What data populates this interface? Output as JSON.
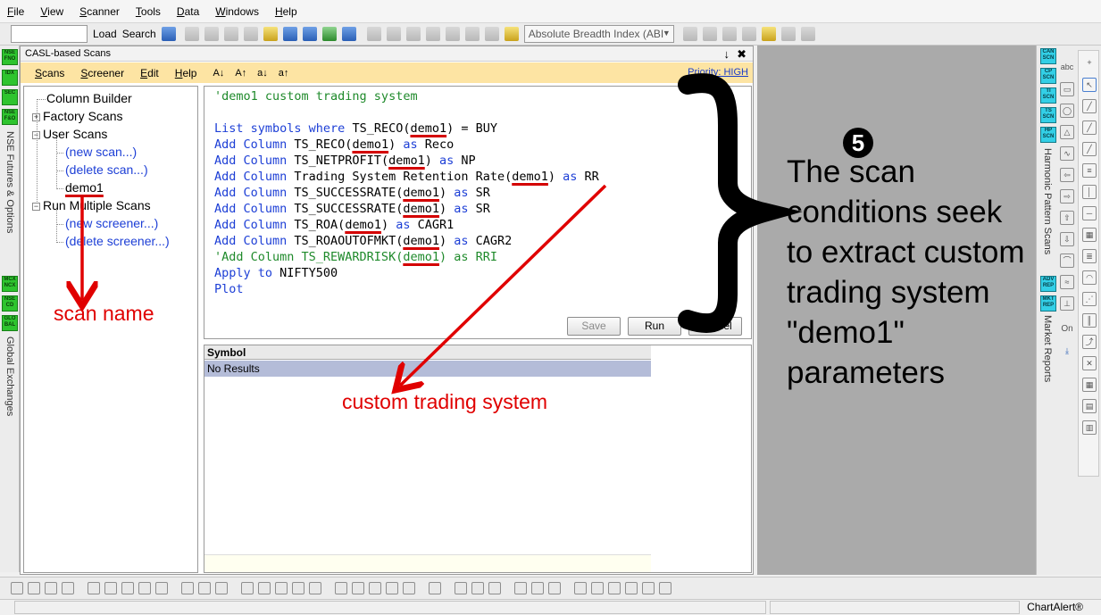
{
  "menu": [
    "File",
    "View",
    "Scanner",
    "Tools",
    "Data",
    "Windows",
    "Help"
  ],
  "toolbar": {
    "load": "Load",
    "search": "Search",
    "breadth_select": "Absolute Breadth Index (ABI"
  },
  "left_sidebar": {
    "buttons_top": [
      "NSE FNO",
      "IDX",
      "SEC",
      "NSE F&O"
    ],
    "label_top": "NSE Futures & Options",
    "buttons_bottom": [
      "MCX NCX",
      "NSE CD",
      "GLO BAL"
    ],
    "label_bottom": "Global Exchanges"
  },
  "window": {
    "title": "CASL-based Scans",
    "pin": "↓",
    "close": "✖",
    "menu": [
      "Scans",
      "Screener",
      "Edit",
      "Help"
    ],
    "font_sizes": [
      "A↓",
      "A↑",
      "a↓",
      "a↑"
    ],
    "priority": "Priority: HIGH"
  },
  "tree": {
    "column_builder": "Column Builder",
    "factory_scans": "Factory Scans",
    "user_scans": "User Scans",
    "new_scan": "(new scan...)",
    "delete_scan": "(delete scan...)",
    "demo1": "demo1",
    "run_multiple": "Run Multiple Scans",
    "new_screener": "(new screener...)",
    "delete_screener": "(delete screener...)"
  },
  "editor": {
    "comment": "'demo1 custom trading system",
    "lines": [
      {
        "kw": "List symbols where ",
        "pre": "TS_RECO(",
        "ul": "demo1",
        "post": ") = BUY"
      },
      {
        "kw": "Add Column ",
        "pre": "TS_RECO(",
        "ul": "demo1",
        "post": ") ",
        "kw2": "as",
        "tail": " Reco"
      },
      {
        "kw": "Add Column ",
        "pre": "TS_NETPROFIT(",
        "ul": "demo1",
        "post": ") ",
        "kw2": "as",
        "tail": " NP"
      },
      {
        "kw": "Add Column ",
        "pre": "Trading System Retention Rate(",
        "ul": "demo1",
        "post": ") ",
        "kw2": "as",
        "tail": " RR"
      },
      {
        "kw": "Add Column ",
        "pre": "TS_SUCCESSRATE(",
        "ul": "demo1",
        "post": ") ",
        "kw2": "as",
        "tail": " SR"
      },
      {
        "kw": "Add Column ",
        "pre": "TS_SUCCESSRATE(",
        "ul": "demo1",
        "post": ") ",
        "kw2": "as",
        "tail": " SR"
      },
      {
        "kw": "Add Column ",
        "pre": "TS_ROA(",
        "ul": "demo1",
        "post": ") ",
        "kw2": "as",
        "tail": " CAGR1"
      },
      {
        "kw": "Add Column ",
        "pre": "TS_ROAOUTOFMKT(",
        "ul": "demo1",
        "post": ") ",
        "kw2": "as",
        "tail": " CAGR2"
      }
    ],
    "commented_line": {
      "pre": "'Add Column TS_REWARDRISK(",
      "ul": "demo1",
      "post": ") as RRI"
    },
    "apply_kw": "Apply to",
    "apply_val": " NIFTY500",
    "plot": "Plot",
    "save": "Save",
    "run": "Run",
    "cancel": "Cancel"
  },
  "results": {
    "header": "Symbol",
    "row": "No Results"
  },
  "right_sidebar": {
    "buttons_top": [
      "CAN SCN",
      "CP SCN",
      "TI SCN",
      "TS SCN",
      "HP SCN"
    ],
    "label_top": "Harmonic Pattern Scans",
    "buttons_bottom": [
      "ADV REP",
      "MKT REP"
    ],
    "label_bottom": "Market Reports"
  },
  "drawing_tools": [
    "abc",
    "On"
  ],
  "status": {
    "brand": "ChartAlert®"
  },
  "annotations": {
    "scan_name": "scan name",
    "custom_trading_system": "custom trading system",
    "step": "5",
    "explanation": "The scan conditions seek to extract custom trading system \"demo1\" parameters"
  }
}
